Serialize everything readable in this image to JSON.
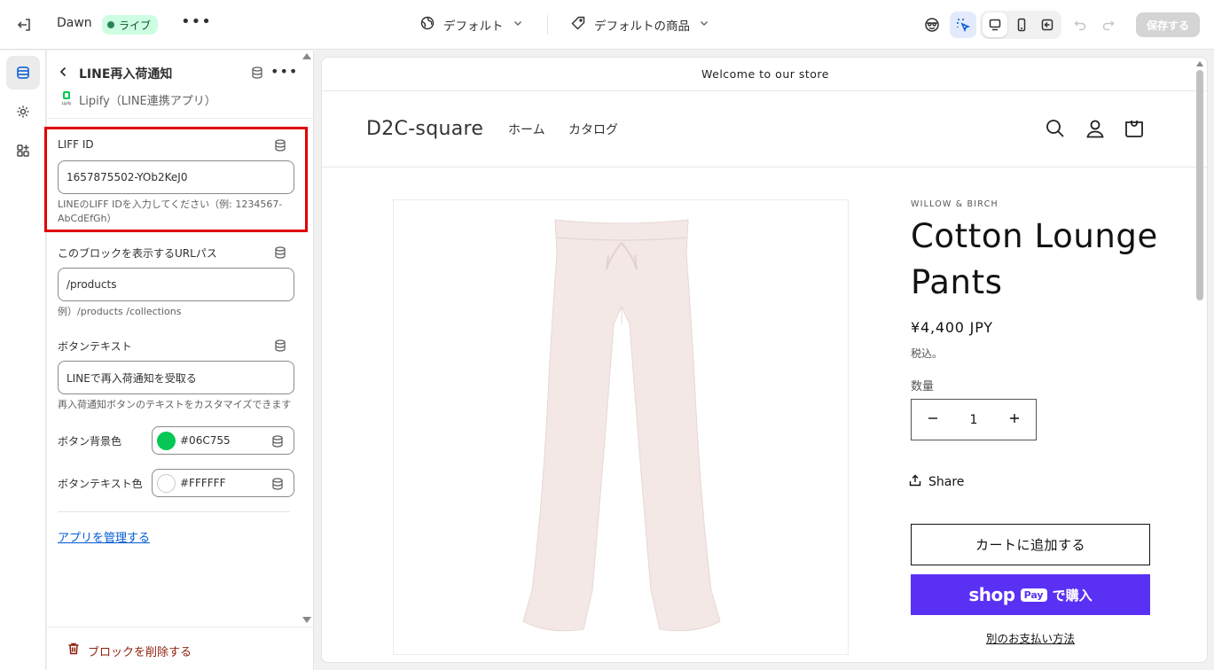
{
  "topbar": {
    "theme_name": "Dawn",
    "live_badge": "ライブ",
    "more": "•••",
    "template_label": "デフォルト",
    "product_label": "デフォルトの商品",
    "save_label": "保存する"
  },
  "panel": {
    "title": "LINE再入荷通知",
    "app_name": "Lipify（LINE連携アプリ）",
    "app_icon_caption": "Lipify",
    "fields": {
      "liff": {
        "label": "LIFF ID",
        "value": "1657875502-YOb2KeJ0",
        "help": "LINEのLIFF IDを入力してください（例: 1234567-AbCdEfGh）"
      },
      "url_path": {
        "label": "このブロックを表示するURLパス",
        "value": "/products",
        "help": "例）/products /collections"
      },
      "button_text": {
        "label": "ボタンテキスト",
        "value": "LINEで再入荷通知を受取る",
        "help": "再入荷通知ボタンのテキストをカスタマイズできます"
      },
      "button_bg": {
        "label": "ボタン背景色",
        "value": "#06C755",
        "swatch": "#06c755"
      },
      "button_fg": {
        "label": "ボタンテキスト色",
        "value": "#FFFFFF",
        "swatch": "#ffffff"
      }
    },
    "manage_link": "アプリを管理する",
    "delete_label": "ブロックを削除する"
  },
  "store": {
    "announcement": "Welcome to our store",
    "logo": "D2C-square",
    "nav": [
      "ホーム",
      "カタログ"
    ],
    "vendor": "WILLOW & BIRCH",
    "product_title": "Cotton Lounge Pants",
    "price": "¥4,400 JPY",
    "tax_note": "税込。",
    "quantity_label": "数量",
    "quantity_value": "1",
    "share_label": "Share",
    "add_to_cart": "カートに追加する",
    "shoppay_brand": "shop",
    "shoppay_pay": "Pay",
    "shoppay_label": "で購入",
    "more_payment": "別のお支払い方法",
    "colors": {
      "shoppay": "#5a31f4",
      "pants": "#f3e8e6"
    }
  },
  "icons": [
    "exit-icon",
    "globe-icon",
    "tag-icon",
    "chevron-down-icon",
    "inspector-icon",
    "select-icon",
    "desktop-icon",
    "mobile-icon",
    "fullscreen-icon",
    "undo-icon",
    "redo-icon",
    "sections-icon",
    "settings-icon",
    "apps-icon",
    "database-icon",
    "trash-icon",
    "search-icon",
    "account-icon",
    "cart-icon",
    "share-icon",
    "minus-icon",
    "plus-icon"
  ]
}
